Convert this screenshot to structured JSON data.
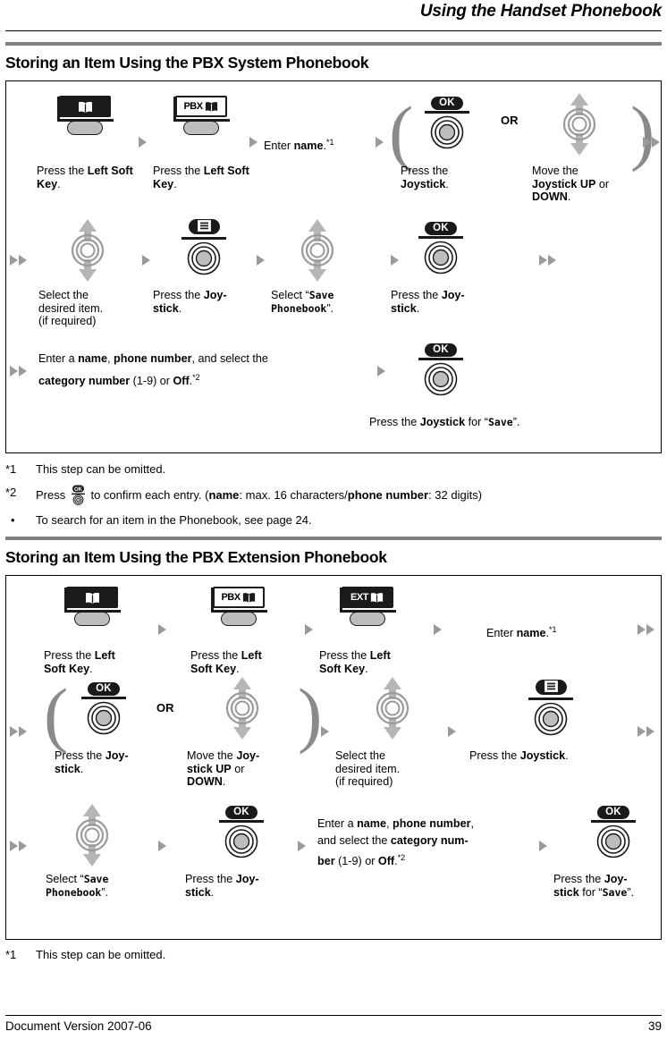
{
  "header": {
    "title": "Using the Handset Phonebook"
  },
  "sections": [
    {
      "heading": "Storing an Item Using the PBX System Phonebook",
      "steps": {
        "s1_caption_a": "Press the ",
        "s1_caption_b": "Left Soft Key",
        "s1_caption_c": ".",
        "enter_name": "Enter ",
        "enter_name_b": "name",
        "enter_name_sup": "*1",
        "press_joystick_a": "Press the ",
        "press_joystick_b": "Joystick",
        "move_joystick_a": "Move the ",
        "move_joystick_b": "Joystick UP",
        "move_joystick_c": " or ",
        "move_joystick_d": "DOWN",
        "or": "OR",
        "select_item_l1": "Select the",
        "select_item_l2": "desired item.",
        "select_item_l3": "(if required)",
        "press_joy_hyphen_a": "Press the ",
        "press_joy_hyphen_b": "Joy-",
        "press_joy_hyphen_c": "stick",
        "select_save_a": "Select “",
        "select_save_mono1": "Save",
        "select_save_mono2": "Phonebook",
        "select_save_b": "”.",
        "enter_all_a": "Enter a ",
        "enter_all_b": "name",
        "enter_all_c": ", ",
        "enter_all_d": "phone number",
        "enter_all_e": ", and select the",
        "enter_all_f": "category number",
        "enter_all_g": " (1-9) or ",
        "enter_all_h": "Off",
        "enter_all_i": ".",
        "enter_all_sup": "*2",
        "press_for_save_a": "Press the ",
        "press_for_save_b": "Joystick",
        "press_for_save_c": " for “",
        "press_for_save_mono": "Save",
        "press_for_save_d": "”."
      },
      "icons": {
        "phonebook_label": "",
        "pbx_label": "PBX",
        "ok_label": "OK",
        "menu_label": "menu"
      },
      "notes": [
        {
          "mark": "*1",
          "text": "This step can be omitted."
        },
        {
          "mark": "*2",
          "pre": "Press ",
          "mid": " to confirm each entry. (",
          "b1": "name",
          "t1": ": max. 16 characters/",
          "b2": "phone number",
          "t2": ": 32 digits)"
        },
        {
          "mark": "•",
          "text": "To search for an item in the Phonebook, see page 24."
        }
      ]
    },
    {
      "heading": "Storing an Item Using the PBX Extension Phonebook",
      "icons": {
        "pbx_label": "PBX",
        "ext_label": "EXT",
        "ok_label": "OK"
      },
      "steps": {
        "press_left_soft_a": "Press the ",
        "press_left_soft_b": "Left",
        "press_left_soft_c": "Soft Key",
        "enter_name": "Enter ",
        "enter_name_b": "name",
        "enter_name_sup": "*1",
        "or": "OR",
        "press_joy_a": "Press the ",
        "press_joy_b": "Joy-",
        "press_joy_c": "stick",
        "move_joy_a": "Move the ",
        "move_joy_b": "Joy-",
        "move_joy_c": "stick UP",
        "move_joy_d": " or",
        "move_joy_e": "DOWN",
        "select_item_l1": "Select the",
        "select_item_l2": "desired item.",
        "select_item_l3": "(if required)",
        "press_joystick_a": "Press the ",
        "press_joystick_b": "Joystick",
        "select_save_a": "Select “",
        "select_save_mono1": "Save",
        "select_save_mono2": "Phonebook",
        "select_save_b": "”.",
        "enter_all_a": "Enter a ",
        "enter_all_b": "name",
        "enter_all_c": ", ",
        "enter_all_d": "phone number",
        "enter_all_e": ",",
        "enter_all_f": "and select the ",
        "enter_all_g": "category num-",
        "enter_all_h": "ber",
        "enter_all_i": " (1-9) or ",
        "enter_all_j": "Off",
        "enter_all_k": ".",
        "enter_all_sup": "*2",
        "press_for_save_a": "Press the ",
        "press_for_save_b": "Joy-",
        "press_for_save_c": "stick",
        "press_for_save_d": " for “",
        "press_for_save_mono": "Save",
        "press_for_save_e": "”."
      },
      "notes": [
        {
          "mark": "*1",
          "text": "This step can be omitted."
        }
      ]
    }
  ],
  "footer": {
    "version": "Document Version 2007-06",
    "page": "39"
  },
  "colors": {
    "rule_gray": "#808080",
    "arrow_gray": "#9a9a9a",
    "key_gray": "#bdbdbd",
    "dark": "#1a1a1a"
  }
}
